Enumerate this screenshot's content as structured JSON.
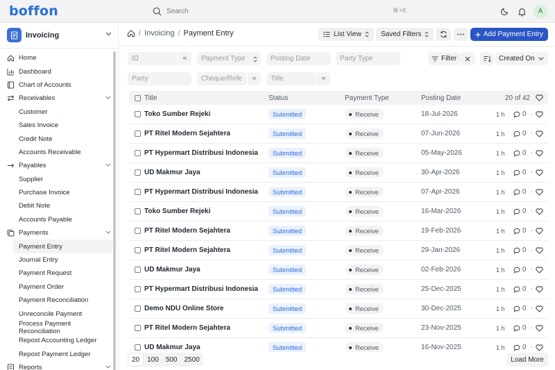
{
  "app": {
    "logo": "boffon"
  },
  "navbar": {
    "search_placeholder": "Search",
    "search_shortcut": "⌘+K",
    "avatar_initial": "A"
  },
  "workspace": {
    "title": "Invoicing"
  },
  "sidebar": {
    "items": [
      {
        "label": "Home",
        "level": "top",
        "icon": "home-icon"
      },
      {
        "label": "Dashboard",
        "level": "top",
        "icon": "bar-chart-icon"
      },
      {
        "label": "Chart of Accounts",
        "level": "top",
        "icon": "book-icon"
      },
      {
        "label": "Receivables",
        "level": "top",
        "icon": "arrow-left-right-icon",
        "expandable": true
      },
      {
        "label": "Customer",
        "level": "child"
      },
      {
        "label": "Sales Invoice",
        "level": "child"
      },
      {
        "label": "Credit Note",
        "level": "child"
      },
      {
        "label": "Accounts Receivable",
        "level": "child"
      },
      {
        "label": "Payables",
        "level": "top",
        "icon": "arrow-right-icon",
        "expandable": true
      },
      {
        "label": "Supplier",
        "level": "child"
      },
      {
        "label": "Purchase Invoice",
        "level": "child"
      },
      {
        "label": "Debit Note",
        "level": "child"
      },
      {
        "label": "Accounts Payable",
        "level": "child"
      },
      {
        "label": "Payments",
        "level": "top",
        "icon": "payments-icon",
        "expandable": true
      },
      {
        "label": "Payment Entry",
        "level": "child",
        "active": true
      },
      {
        "label": "Journal Entry",
        "level": "child"
      },
      {
        "label": "Payment Request",
        "level": "child"
      },
      {
        "label": "Payment Order",
        "level": "child"
      },
      {
        "label": "Payment Reconciliation",
        "level": "child"
      },
      {
        "label": "Unreconcile Payment",
        "level": "child"
      },
      {
        "label": "Process Payment Reconciliation",
        "level": "child"
      },
      {
        "label": "Repost Accounting Ledger",
        "level": "child"
      },
      {
        "label": "Repost Payment Ledger",
        "level": "child"
      },
      {
        "label": "Reports",
        "level": "top",
        "icon": "report-icon",
        "expandable": true
      }
    ]
  },
  "header": {
    "breadcrumb_parent": "Invoicing",
    "breadcrumb_current": "Payment Entry",
    "list_view_label": "List View",
    "saved_filters_label": "Saved Filters",
    "add_button_label": "Add Payment Entry"
  },
  "filters": {
    "id_placeholder": "ID",
    "payment_type_placeholder": "Payment Type",
    "posting_date_placeholder": "Posting Date",
    "party_type_placeholder": "Party Type",
    "party_placeholder": "Party",
    "cheque_placeholder": "Cheque/Refe",
    "title_placeholder": "Title",
    "op_symbol": "≈",
    "filter_label": "Filter",
    "sort_label": "Created On"
  },
  "table": {
    "columns": {
      "title": "Title",
      "status": "Status",
      "payment_type": "Payment Type",
      "posting_date": "Posting Date"
    },
    "count": "20 of 42",
    "rows": [
      {
        "title": "Toko Sumber Rejeki",
        "status": "Submitted",
        "payment_type": "Receive",
        "posting_date": "18-Jul-2026",
        "modified": "1 h",
        "comments": "0"
      },
      {
        "title": "PT Ritel Modern Sejahtera",
        "status": "Submitted",
        "payment_type": "Receive",
        "posting_date": "07-Jun-2026",
        "modified": "1 h",
        "comments": "0"
      },
      {
        "title": "PT Hypermart Distribusi Indonesia",
        "status": "Submitted",
        "payment_type": "Receive",
        "posting_date": "05-May-2026",
        "modified": "1 h",
        "comments": "0"
      },
      {
        "title": "UD Makmur Jaya",
        "status": "Submitted",
        "payment_type": "Receive",
        "posting_date": "30-Apr-2026",
        "modified": "1 h",
        "comments": "0"
      },
      {
        "title": "PT Hypermart Distribusi Indonesia",
        "status": "Submitted",
        "payment_type": "Receive",
        "posting_date": "07-Apr-2026",
        "modified": "1 h",
        "comments": "0"
      },
      {
        "title": "Toko Sumber Rejeki",
        "status": "Submitted",
        "payment_type": "Receive",
        "posting_date": "16-Mar-2026",
        "modified": "1 h",
        "comments": "0"
      },
      {
        "title": "PT Ritel Modern Sejahtera",
        "status": "Submitted",
        "payment_type": "Receive",
        "posting_date": "19-Feb-2026",
        "modified": "1 h",
        "comments": "0"
      },
      {
        "title": "PT Ritel Modern Sejahtera",
        "status": "Submitted",
        "payment_type": "Receive",
        "posting_date": "29-Jan-2026",
        "modified": "1 h",
        "comments": "0"
      },
      {
        "title": "UD Makmur Jaya",
        "status": "Submitted",
        "payment_type": "Receive",
        "posting_date": "02-Feb-2026",
        "modified": "1 h",
        "comments": "0"
      },
      {
        "title": "PT Hypermart Distribusi Indonesia",
        "status": "Submitted",
        "payment_type": "Receive",
        "posting_date": "25-Dec-2025",
        "modified": "1 h",
        "comments": "0"
      },
      {
        "title": "Demo NDU Online Store",
        "status": "Submitted",
        "payment_type": "Receive",
        "posting_date": "30-Dec-2025",
        "modified": "1 h",
        "comments": "0"
      },
      {
        "title": "PT Ritel Modern Sejahtera",
        "status": "Submitted",
        "payment_type": "Receive",
        "posting_date": "23-Nov-2025",
        "modified": "1 h",
        "comments": "0"
      },
      {
        "title": "UD Makmur Jaya",
        "status": "Submitted",
        "payment_type": "Receive",
        "posting_date": "16-Nov-2025",
        "modified": "1 h",
        "comments": "0"
      }
    ]
  },
  "footer": {
    "page_sizes": [
      "20",
      "100",
      "500",
      "2500"
    ],
    "active_page_size": "20",
    "load_more_label": "Load More"
  },
  "colors": {
    "brand": "#2a6fd6",
    "primary_button": "#2a55c4",
    "status_submitted": "#2d6ad9",
    "status_badge_bg": "#eaf2ff"
  }
}
